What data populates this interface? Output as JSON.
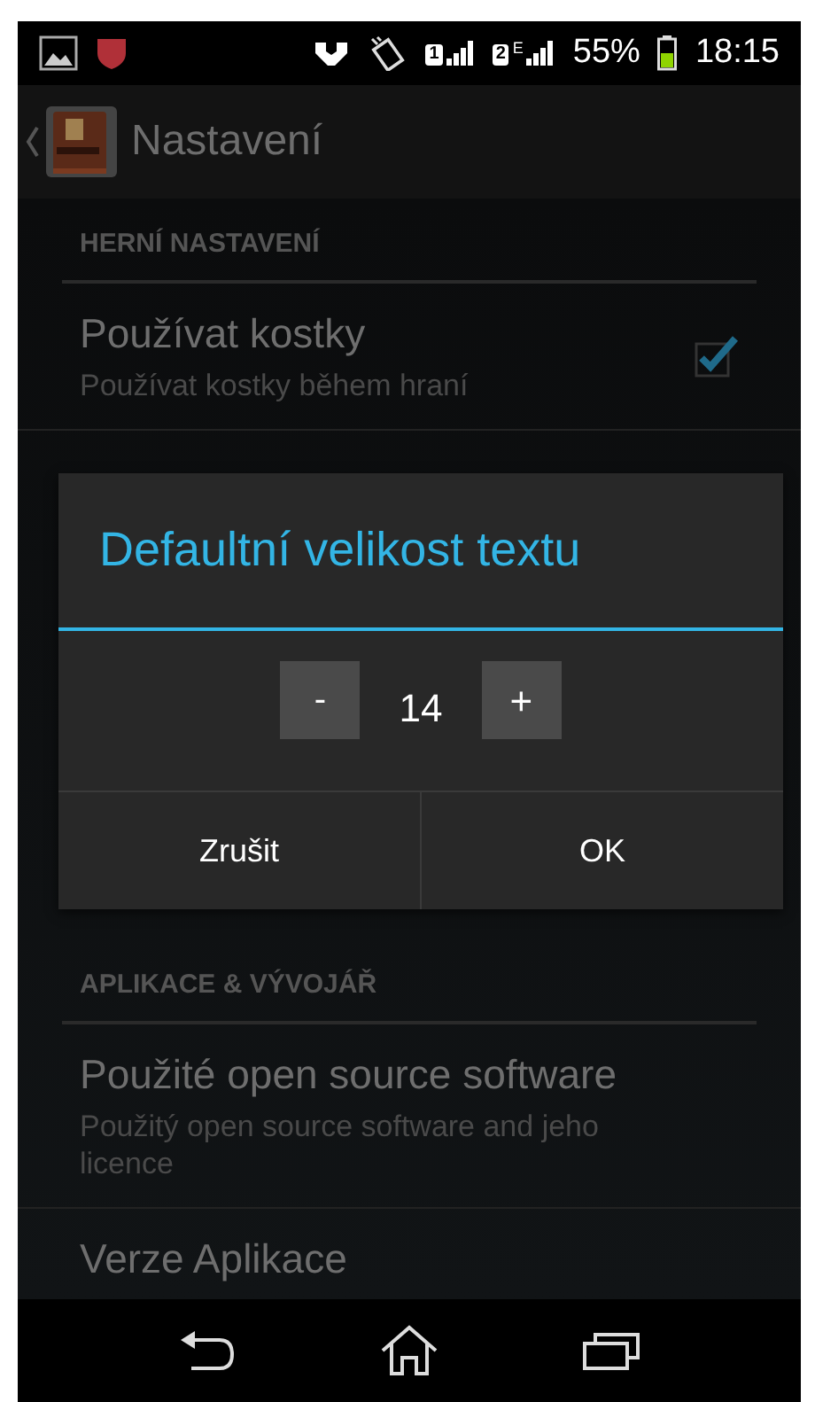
{
  "status_bar": {
    "sims": [
      {
        "label": "1"
      },
      {
        "label": "2",
        "network": "E"
      }
    ],
    "battery": "55%",
    "time": "18:15"
  },
  "action_bar": {
    "title": "Nastavení"
  },
  "sections": [
    {
      "header": "HERNÍ NASTAVENÍ",
      "items": [
        {
          "kind": "checkbox",
          "title": "Používat kostky",
          "summary": "Používat kostky během hraní",
          "checked": true
        }
      ]
    },
    {
      "header": "APLIKACE & VÝVOJÁŘ",
      "items": [
        {
          "kind": "plain",
          "title": "Použité open source software",
          "summary": "Použitý open source software and jeho licence"
        },
        {
          "kind": "plain",
          "title": "Verze Aplikace"
        }
      ]
    }
  ],
  "dialog": {
    "title": "Defaultní velikost textu",
    "decrement": "-",
    "value": "14",
    "increment": "+",
    "buttons": [
      "Zrušit",
      "OK"
    ]
  }
}
